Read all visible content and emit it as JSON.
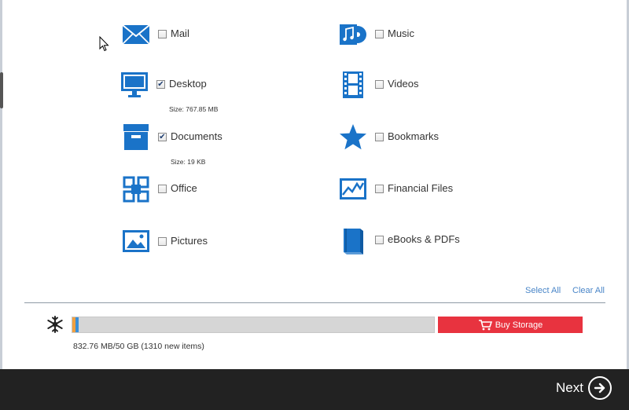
{
  "categories_left": [
    {
      "label": "Mail",
      "checked": false,
      "size": "",
      "icon": "mail-icon"
    },
    {
      "label": "Desktop",
      "checked": true,
      "size": "Size: 767.85 MB",
      "icon": "monitor-icon"
    },
    {
      "label": "Documents",
      "checked": true,
      "size": "Size: 19 KB",
      "icon": "archive-box-icon"
    },
    {
      "label": "Office",
      "checked": false,
      "size": "",
      "icon": "office-icon"
    },
    {
      "label": "Pictures",
      "checked": false,
      "size": "",
      "icon": "picture-icon"
    }
  ],
  "categories_right": [
    {
      "label": "Music",
      "checked": false,
      "size": "",
      "icon": "music-icon"
    },
    {
      "label": "Videos",
      "checked": false,
      "size": "",
      "icon": "film-icon"
    },
    {
      "label": "Bookmarks",
      "checked": false,
      "size": "",
      "icon": "star-icon"
    },
    {
      "label": "Financial Files",
      "checked": false,
      "size": "",
      "icon": "chart-icon"
    },
    {
      "label": "eBooks & PDFs",
      "checked": false,
      "size": "",
      "icon": "book-icon"
    }
  ],
  "actions": {
    "select_all": "Select All",
    "clear_all": "Clear All"
  },
  "storage": {
    "usage_text": "832.76 MB/50 GB (1310 new items)",
    "used_fraction": 0.0166,
    "buy_label": "Buy Storage"
  },
  "footer": {
    "next_label": "Next"
  },
  "colors": {
    "accent": "#1a73c8",
    "buy": "#e8333f",
    "footer": "#222222"
  }
}
